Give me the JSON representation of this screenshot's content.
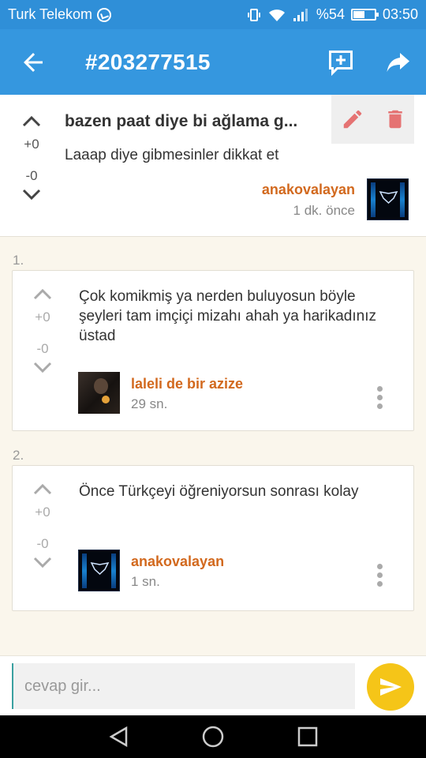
{
  "status_bar": {
    "carrier": "Turk Telekom",
    "battery": "%54",
    "battery_level": 0.54,
    "time": "03:50"
  },
  "app_bar": {
    "title": "#203277515",
    "icons": [
      "back-arrow-icon",
      "add-comment-icon",
      "share-icon"
    ]
  },
  "post": {
    "title": "bazen paat diye bi ağlama g...",
    "body": "Laaap diye gibmesinler dikkat et",
    "upvotes": "+0",
    "downvotes": "-0",
    "author": "anakovalayan",
    "time": "1 dk. önce",
    "actions": [
      "edit-icon",
      "delete-icon"
    ]
  },
  "comments": [
    {
      "index": "1.",
      "text": "Çok komikmiş ya nerden buluyosun böyle şeyleri tam imçiçi mizahı ahah ya harikadınız üstad",
      "upvotes": "+0",
      "downvotes": "-0",
      "author": "laleli de bir azize",
      "time": "29 sn."
    },
    {
      "index": "2.",
      "text": "Önce Türkçeyi öğreniyorsun sonrası kolay",
      "upvotes": "+0",
      "downvotes": "-0",
      "author": "anakovalayan",
      "time": "1 sn."
    }
  ],
  "reply": {
    "placeholder": "cevap gir..."
  },
  "colors": {
    "accent": "#3597df",
    "author": "#d2691e",
    "send_button": "#f5c518",
    "delete": "#e57373"
  }
}
